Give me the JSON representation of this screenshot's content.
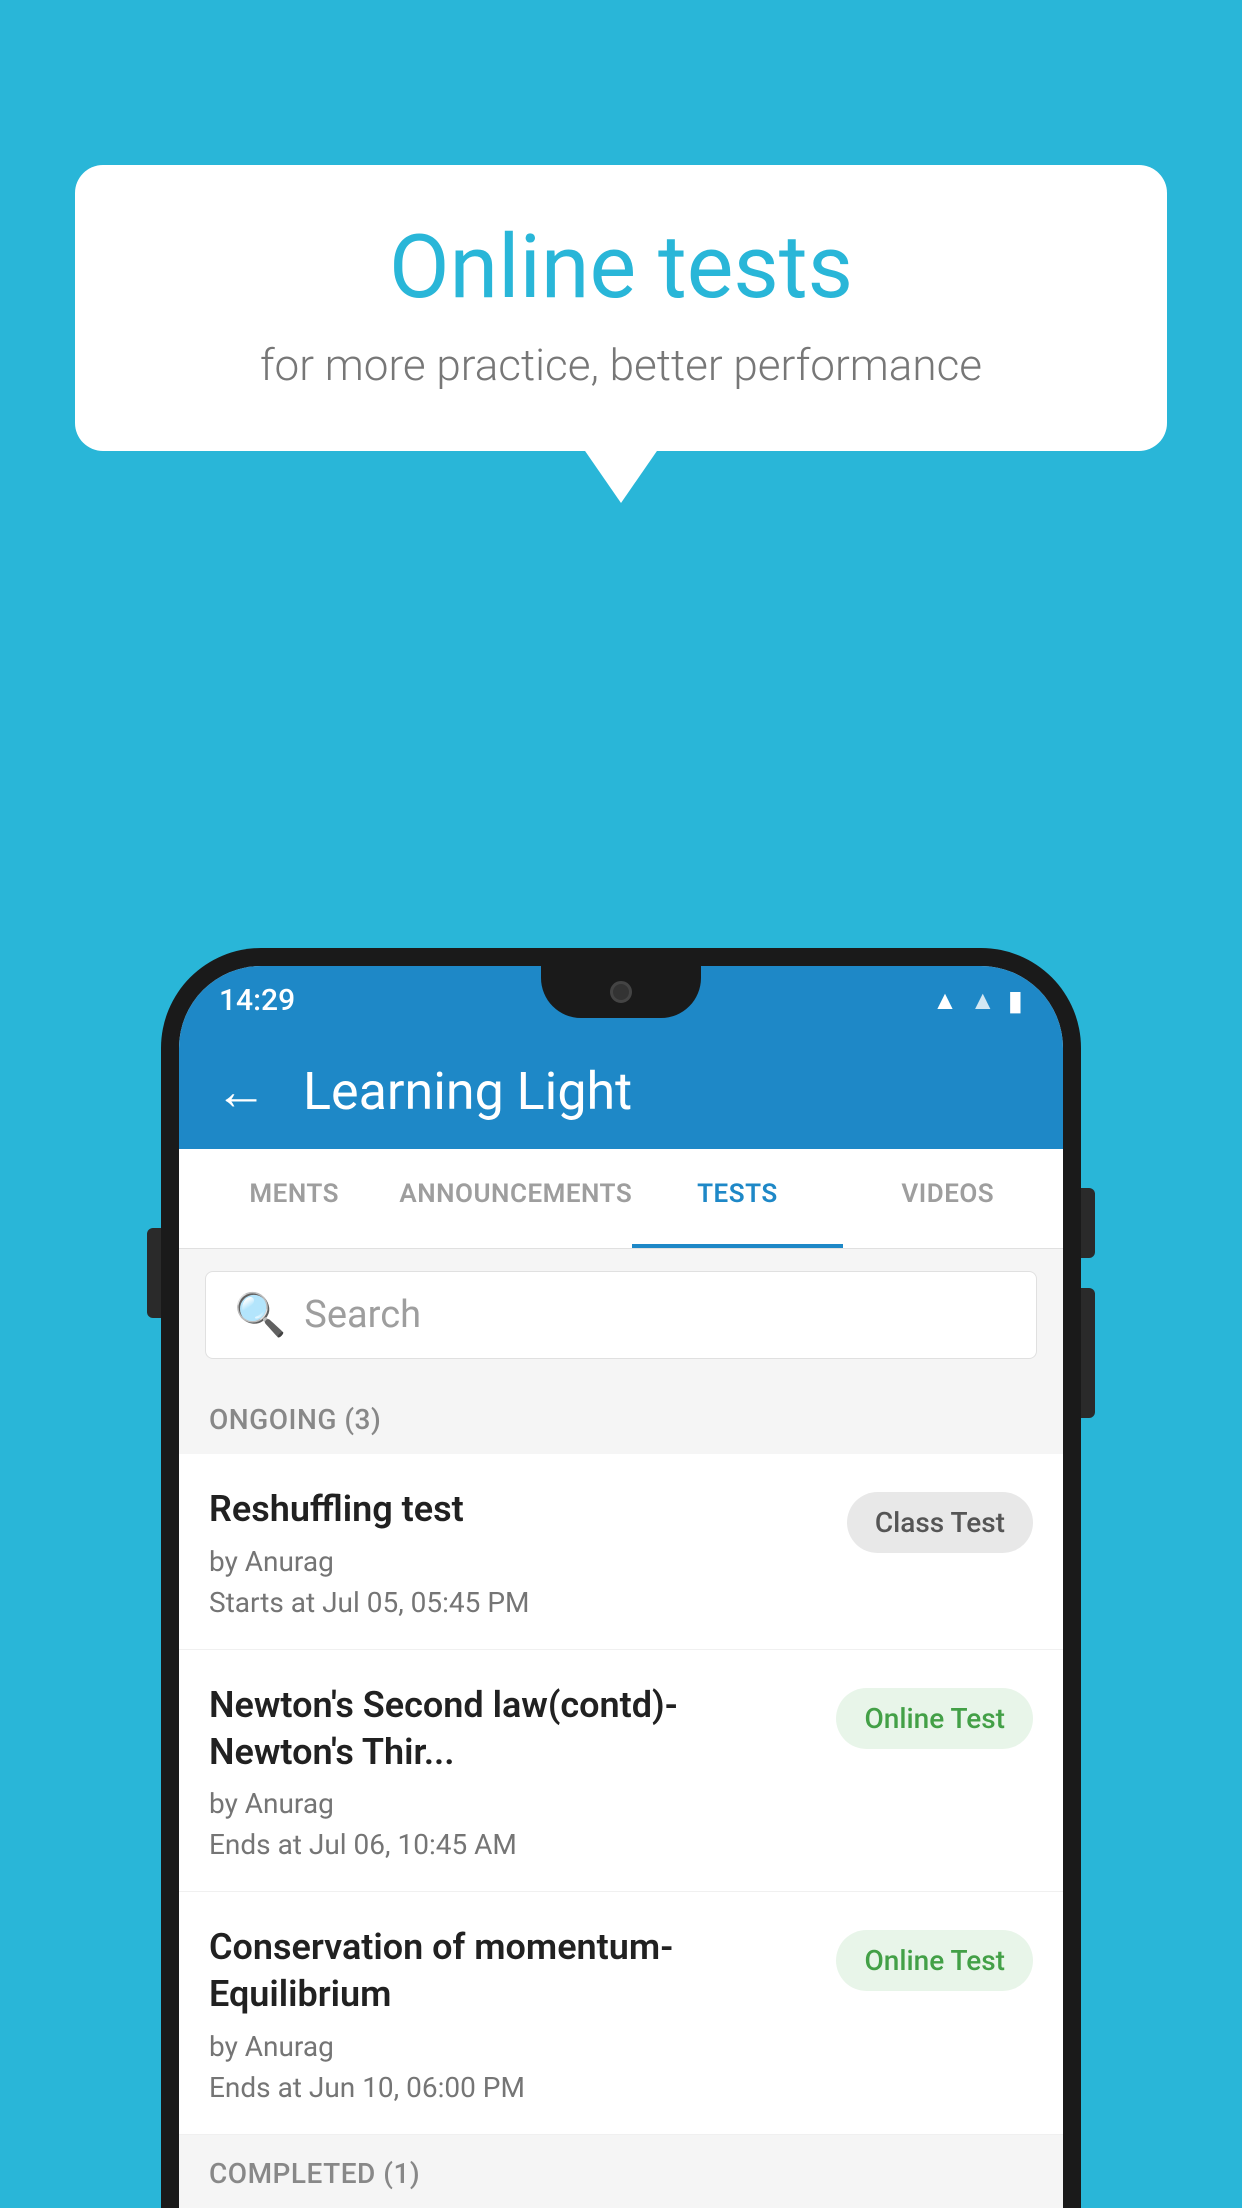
{
  "background_color": "#29b6d8",
  "speech_bubble": {
    "title": "Online tests",
    "subtitle": "for more practice, better performance"
  },
  "phone": {
    "status_bar": {
      "time": "14:29",
      "icons": [
        "wifi",
        "signal",
        "battery"
      ]
    },
    "toolbar": {
      "back_label": "←",
      "title": "Learning Light"
    },
    "tabs": [
      {
        "label": "MENTS",
        "active": false
      },
      {
        "label": "ANNOUNCEMENTS",
        "active": false
      },
      {
        "label": "TESTS",
        "active": true
      },
      {
        "label": "VIDEOS",
        "active": false
      }
    ],
    "search": {
      "placeholder": "Search"
    },
    "sections": [
      {
        "header": "ONGOING (3)",
        "items": [
          {
            "name": "Reshuffling test",
            "author": "by Anurag",
            "date": "Starts at  Jul 05, 05:45 PM",
            "badge": "Class Test",
            "badge_type": "class"
          },
          {
            "name": "Newton's Second law(contd)-Newton's Thir...",
            "author": "by Anurag",
            "date": "Ends at  Jul 06, 10:45 AM",
            "badge": "Online Test",
            "badge_type": "online"
          },
          {
            "name": "Conservation of momentum-Equilibrium",
            "author": "by Anurag",
            "date": "Ends at  Jun 10, 06:00 PM",
            "badge": "Online Test",
            "badge_type": "online"
          }
        ]
      },
      {
        "header": "COMPLETED (1)",
        "items": []
      }
    ]
  }
}
